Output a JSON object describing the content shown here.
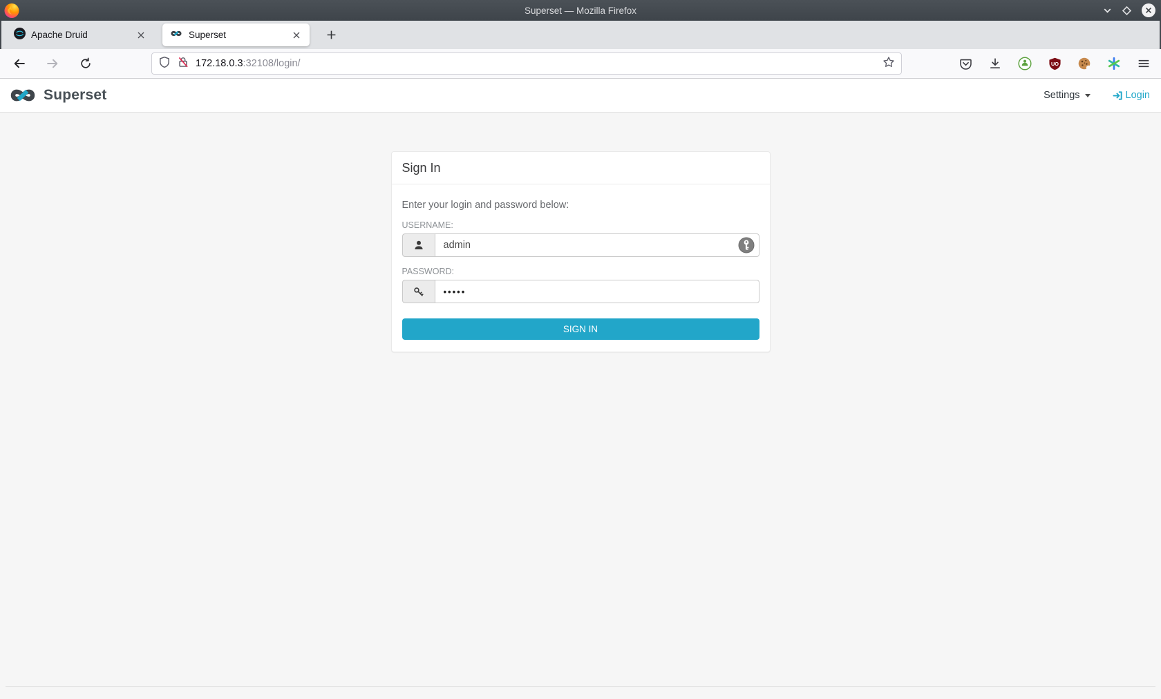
{
  "window": {
    "title": "Superset — Mozilla Firefox"
  },
  "browser": {
    "tabs": [
      {
        "label": "Apache Druid"
      },
      {
        "label": "Superset"
      }
    ],
    "url": {
      "host": "172.18.0.3",
      "rest": ":32108/login/"
    },
    "ublock_badge": "UO"
  },
  "app": {
    "brand": "Superset",
    "settings_label": "Settings",
    "login_label": "Login"
  },
  "login": {
    "title": "Sign In",
    "instructions": "Enter your login and password below:",
    "username_label": "USERNAME:",
    "username_value": "admin",
    "password_label": "PASSWORD:",
    "password_value": "•••••",
    "submit_label": "SIGN IN"
  },
  "colors": {
    "primary": "#20a7c9",
    "titlebar": "#43484e",
    "ublock_red": "#7c0d15"
  }
}
